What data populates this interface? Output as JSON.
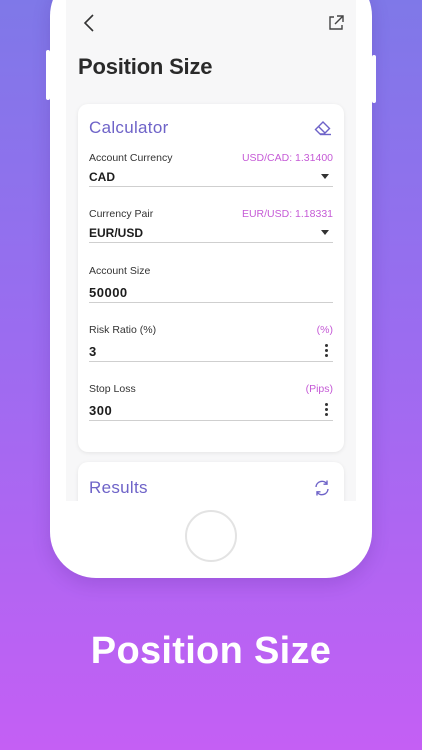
{
  "nav": {
    "back_icon": "chevron-left-icon",
    "share_icon": "external-link-icon"
  },
  "page_title": "Position Size",
  "calculator": {
    "title": "Calculator",
    "clear_icon": "eraser-icon",
    "fields": [
      {
        "label": "Account Currency",
        "hint": "USD/CAD: 1.31400",
        "value": "CAD",
        "control": "dropdown"
      },
      {
        "label": "Currency Pair",
        "hint": "EUR/USD: 1.18331",
        "value": "EUR/USD",
        "control": "dropdown"
      },
      {
        "label": "Account Size",
        "hint": "",
        "value": "50000",
        "control": "input"
      },
      {
        "label": "Risk Ratio (%)",
        "hint": "(%)",
        "value": "3",
        "control": "menu"
      },
      {
        "label": "Stop Loss",
        "hint": "(Pips)",
        "value": "300",
        "control": "menu"
      }
    ]
  },
  "results": {
    "title": "Results",
    "refresh_icon": "refresh-icon"
  },
  "caption": "Position Size",
  "colors": {
    "accent": "#6e63c8",
    "hint": "#c55ad6",
    "gradient_top": "#7f78e8",
    "gradient_bottom": "#c45ff4"
  }
}
